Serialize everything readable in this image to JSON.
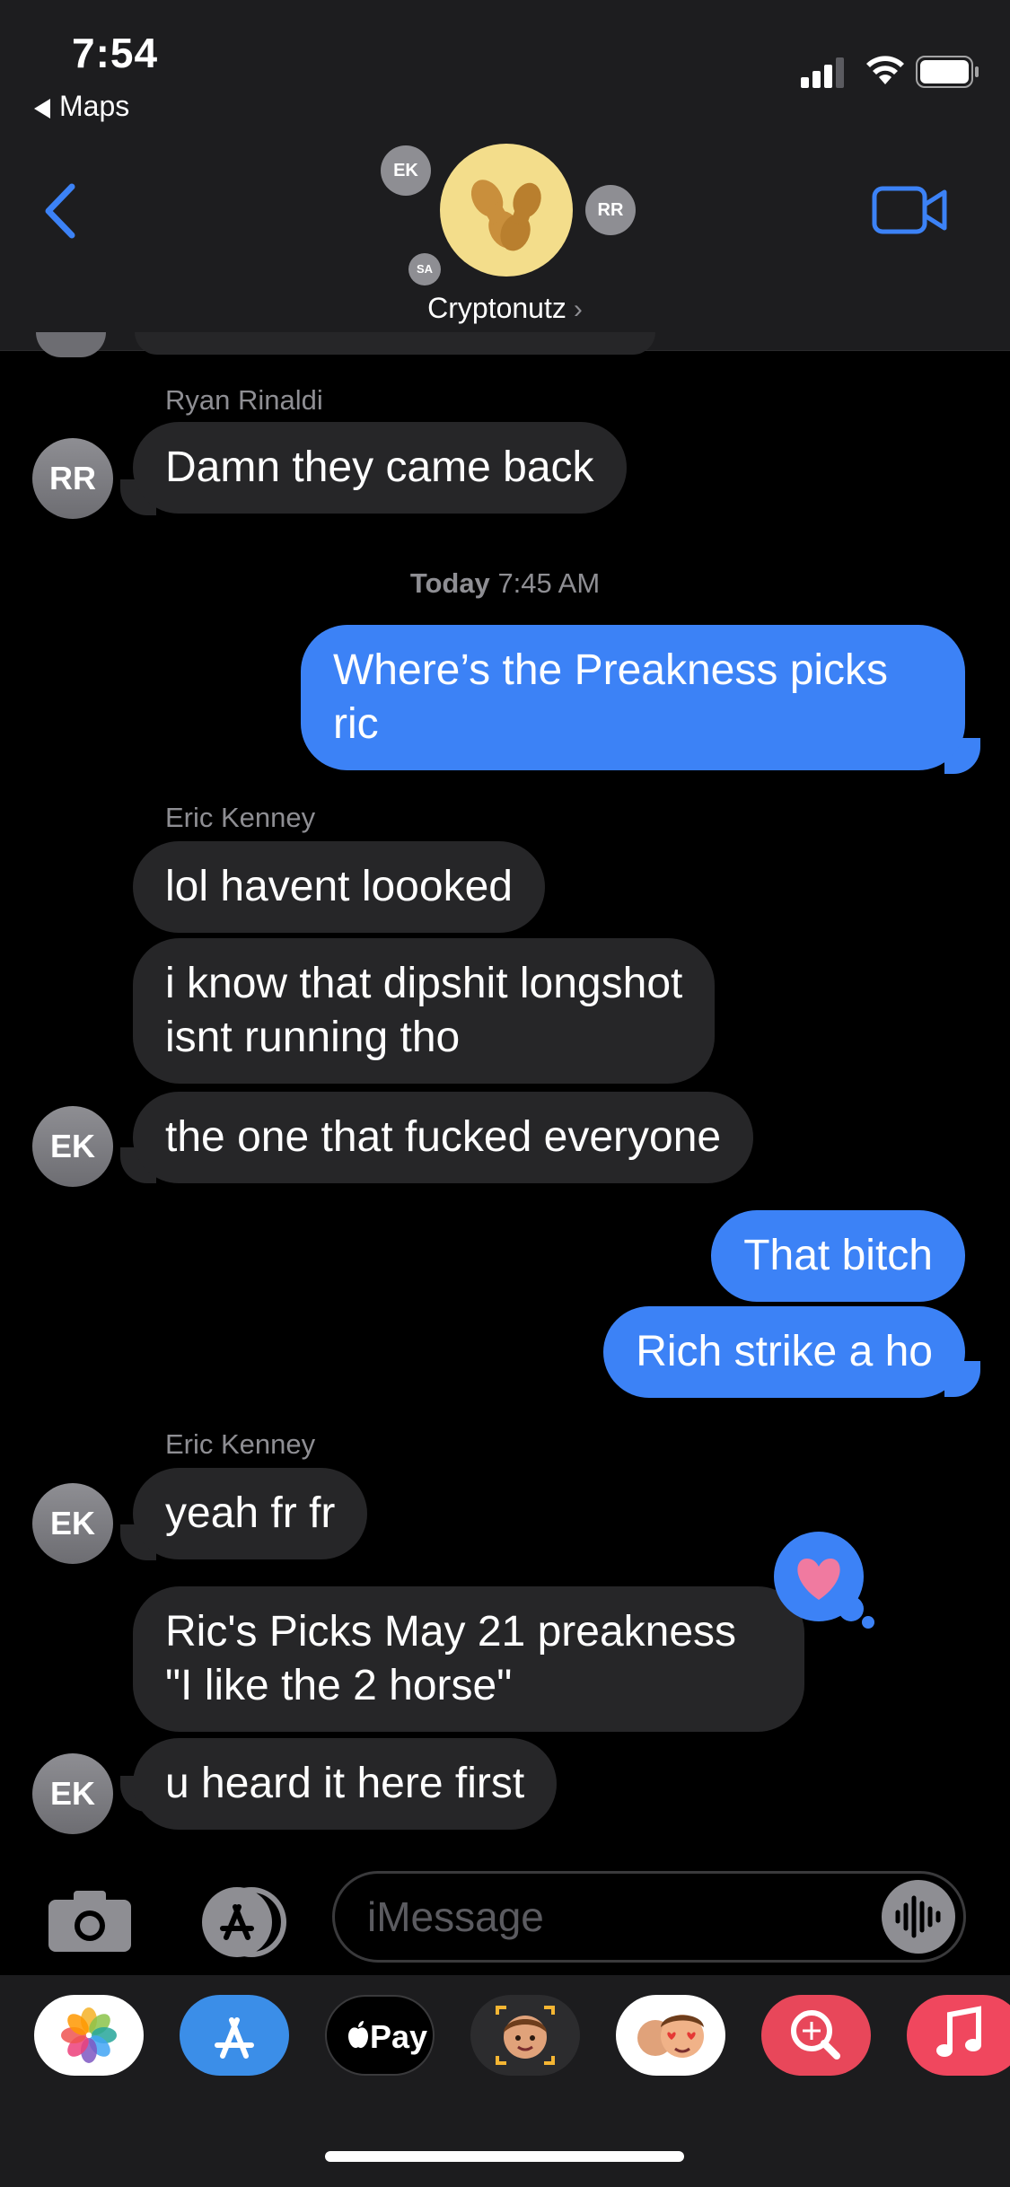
{
  "status": {
    "time": "7:54",
    "back_app": "Maps"
  },
  "header": {
    "group_name": "Cryptonutz",
    "chevron": "›",
    "member_initials": [
      "EK",
      "RR",
      "SA"
    ]
  },
  "messages": {
    "block1": {
      "sender": "Ryan Rinaldi",
      "text": "Damn they came back",
      "avatar": "RR"
    },
    "timestamp": {
      "day": "Today",
      "time": "7:45 AM"
    },
    "out1": {
      "line1": "Where’s the Preakness picks",
      "line2": "ric"
    },
    "block2": {
      "sender": "Eric Kenney",
      "m1": "lol havent loooked",
      "m2_line1": "i know that dipshit longshot",
      "m2_line2": "isnt running tho",
      "m3": "the one that fucked everyone",
      "avatar": "EK"
    },
    "out2": "That bitch",
    "out3": "Rich strike a ho",
    "block3": {
      "sender": "Eric Kenney",
      "m1": "yeah fr fr",
      "m2_line1": "Ric's Picks May 21 preakness",
      "m2_line2": "\"I like the 2 horse\"",
      "m3": "u heard it here first",
      "avatar1": "EK",
      "avatar2": "EK"
    }
  },
  "input": {
    "placeholder": "iMessage"
  },
  "drawer": {
    "apps": [
      "photos-icon",
      "app-store-icon",
      "apple-pay-icon",
      "memoji-icon",
      "animoji-icon",
      "web-images-icon",
      "music-icon"
    ],
    "apple_pay_label": "Pay"
  },
  "colors": {
    "accent": "#3c82f6",
    "incoming": "#262628",
    "reaction_heart": "#f07aa0"
  }
}
